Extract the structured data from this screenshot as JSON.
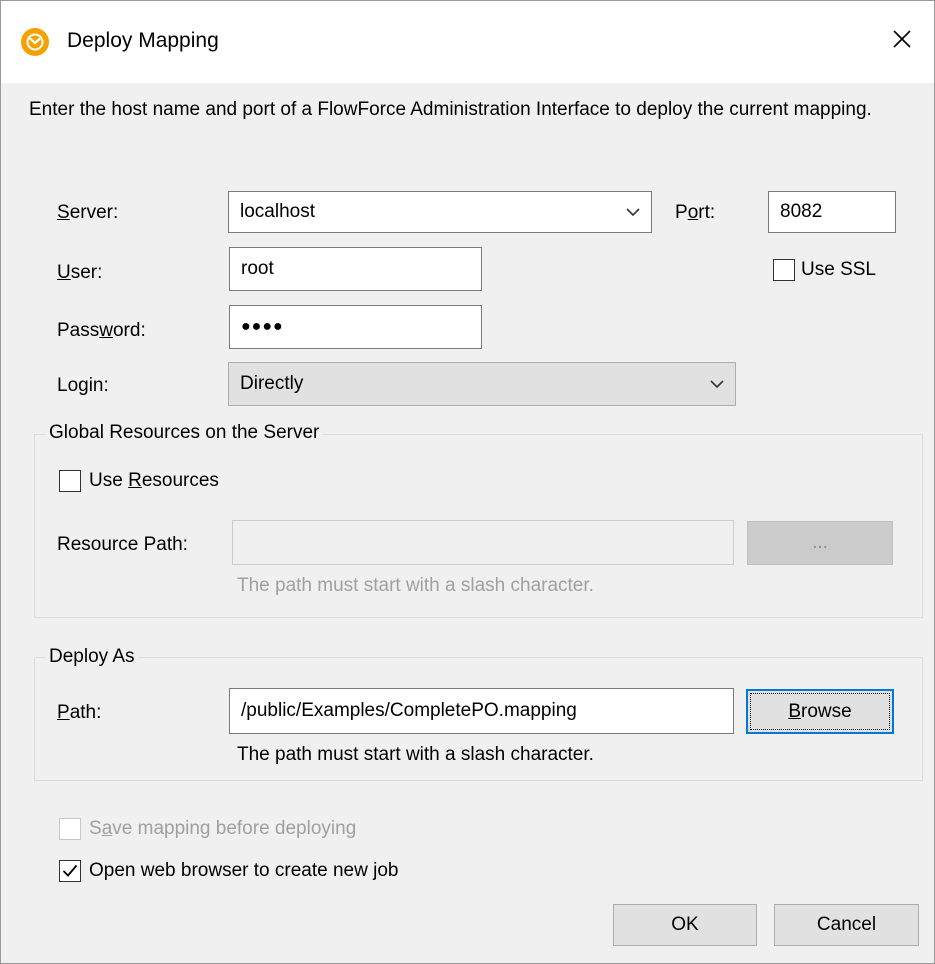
{
  "window": {
    "title": "Deploy Mapping",
    "close_glyph": "✕"
  },
  "description": "Enter the host name and port of a FlowForce Administration Interface to deploy the current mapping.",
  "server": {
    "label_u": "S",
    "label_rest": "erver:",
    "value": "localhost"
  },
  "port": {
    "label_pre": "P",
    "label_u": "o",
    "label_rest": "rt:",
    "value": "8082"
  },
  "use_ssl": {
    "label": "Use SSL",
    "checked": false
  },
  "user": {
    "label_u": "U",
    "label_rest": "ser:",
    "value": "root"
  },
  "password": {
    "label_pre": "Pass",
    "label_u": "w",
    "label_rest": "ord:",
    "value": "●●●●"
  },
  "login": {
    "label": "Login:",
    "value": "Directly"
  },
  "global_resources": {
    "title": "Global Resources on the Server",
    "use_resources": {
      "label_pre": "Use ",
      "label_u": "R",
      "label_rest": "esources",
      "checked": false
    },
    "resource_path_label": "Resource Path:",
    "resource_path_value": "",
    "browse_label": "...",
    "hint": "The path must start with a slash character."
  },
  "deploy_as": {
    "title": "Deploy As",
    "path_label_u": "P",
    "path_label_rest": "ath:",
    "path_value": "/public/Examples/CompletePO.mapping",
    "browse_label_u": "B",
    "browse_label_rest": "rowse",
    "hint": "The path must start with a slash character."
  },
  "save_mapping": {
    "label_pre": "S",
    "label_u": "a",
    "label_rest": "ve mapping before deploying",
    "checked": false,
    "disabled": true
  },
  "open_browser": {
    "label_pre": "Open web browser to create new ",
    "label_u": "j",
    "label_rest": "ob",
    "checked": true
  },
  "buttons": {
    "ok": "OK",
    "cancel": "Cancel"
  },
  "colors": {
    "focus_blue": "#0078d7",
    "dialog_bg": "#f0f0f0",
    "app_icon": "#f5a100"
  }
}
